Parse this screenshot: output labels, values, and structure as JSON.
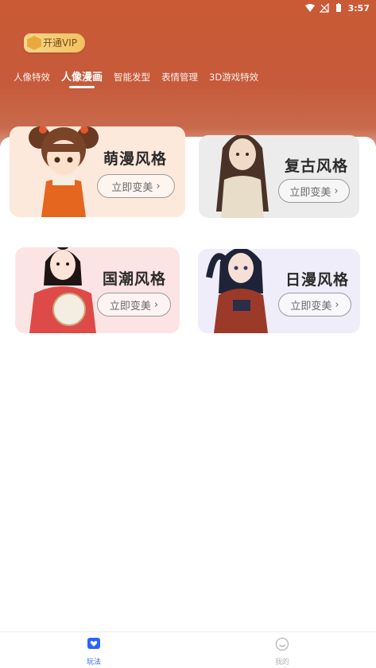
{
  "status_bar": {
    "time": "3:57"
  },
  "vip": {
    "label": "开通VIP"
  },
  "tabs": [
    {
      "label": "人像特效",
      "active": false
    },
    {
      "label": "人像漫画",
      "active": true
    },
    {
      "label": "智能发型",
      "active": false
    },
    {
      "label": "表情管理",
      "active": false
    },
    {
      "label": "3D游戏特效",
      "active": false
    }
  ],
  "cards": [
    {
      "title": "萌漫风格",
      "button": "立即变美",
      "bg": "#fde9dc"
    },
    {
      "title": "复古风格",
      "button": "立即变美",
      "bg": "#ececec"
    },
    {
      "title": "国潮风格",
      "button": "立即变美",
      "bg": "#fde4e4"
    },
    {
      "title": "日漫风格",
      "button": "立即变美",
      "bg": "#efedf9"
    }
  ],
  "bottom_nav": [
    {
      "label": "玩法",
      "active": true,
      "icon": "heart-chat-icon"
    },
    {
      "label": "我的",
      "active": false,
      "icon": "smile-icon"
    }
  ],
  "colors": {
    "header": "#c95a35",
    "nav_active": "#2962ff",
    "nav_inactive": "#b5b5b5"
  }
}
